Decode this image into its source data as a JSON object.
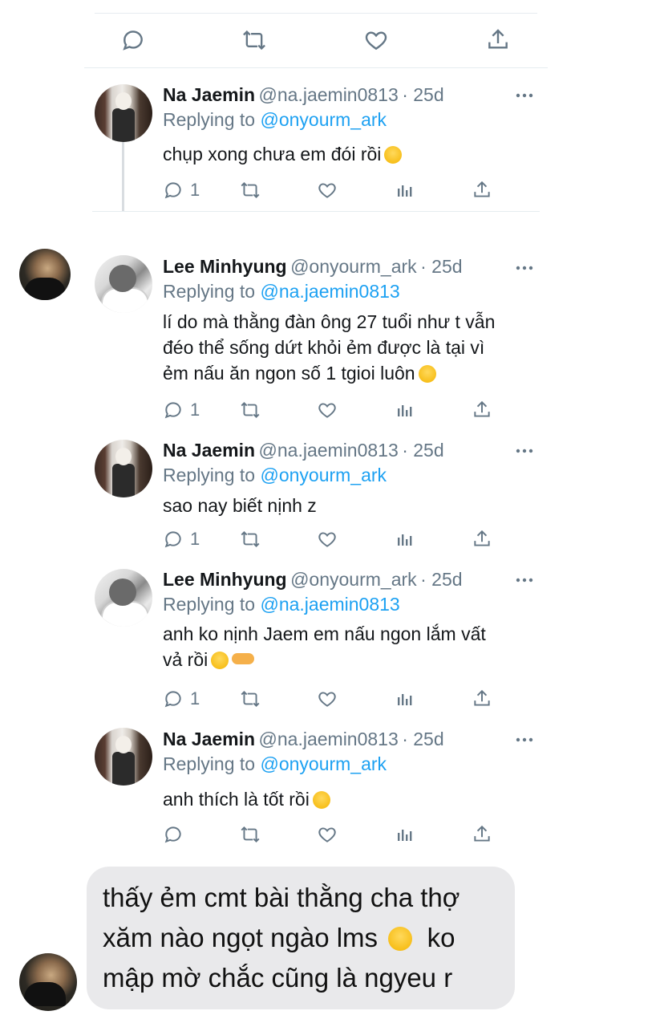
{
  "top_actions": {},
  "tweets": [
    {
      "name": "Na Jaemin",
      "handle": "@na.jaemin0813",
      "age": "· 25d",
      "replying_prefix": "Replying to",
      "replying_to": "@onyourm_ark",
      "text_lines": [
        "chụp xong chưa em đói rồi"
      ],
      "reply_count": "1"
    },
    {
      "name": "Lee Minhyung",
      "handle": "@onyourm_ark",
      "age": "· 25d",
      "replying_prefix": "Replying to",
      "replying_to": "@na.jaemin0813",
      "text_lines": [
        "lí do mà thằng đàn ông 27 tuổi như t vẫn",
        "đéo thể sống dứt khỏi ẻm được là tại vì",
        "ẻm nấu ăn ngon số 1 tgioi luôn"
      ],
      "reply_count": "1"
    },
    {
      "name": "Na Jaemin",
      "handle": "@na.jaemin0813",
      "age": "· 25d",
      "replying_prefix": "Replying to",
      "replying_to": "@onyourm_ark",
      "text_lines": [
        "sao nay biết nịnh z"
      ],
      "reply_count": "1"
    },
    {
      "name": "Lee Minhyung",
      "handle": "@onyourm_ark",
      "age": "· 25d",
      "replying_prefix": "Replying to",
      "replying_to": "@na.jaemin0813",
      "text_lines": [
        "anh ko nịnh Jaem em nấu ngon lắm vất",
        "vả rồi"
      ],
      "reply_count": "1"
    },
    {
      "name": "Na Jaemin",
      "handle": "@na.jaemin0813",
      "age": "· 25d",
      "replying_prefix": "Replying to",
      "replying_to": "@onyourm_ark",
      "text_lines": [
        "anh thích là tốt rồi"
      ],
      "reply_count": ""
    }
  ],
  "message_bubble": {
    "lines": [
      "thấy ẻm cmt bài thằng cha thợ",
      "xăm nào ngọt ngào lms",
      "ko",
      "mập mờ chắc cũng là ngyeu r"
    ]
  },
  "colors": {
    "text": "#14171a",
    "muted": "#657786",
    "link": "#1da1f2",
    "bubble": "#e9e9eb"
  }
}
